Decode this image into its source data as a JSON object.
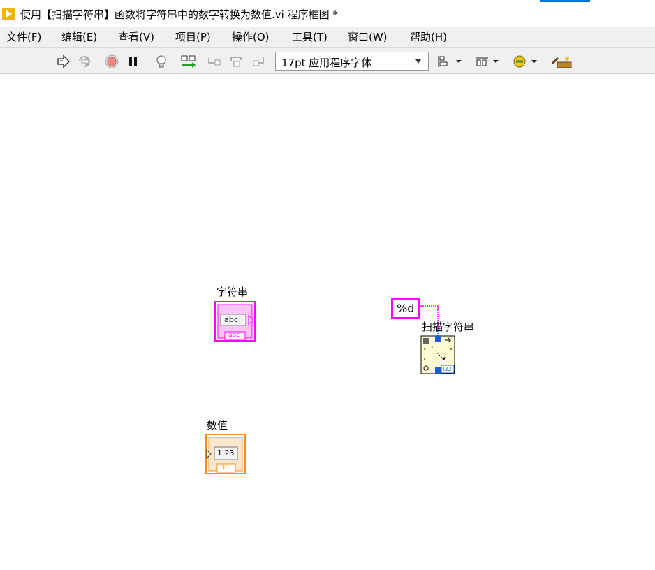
{
  "window": {
    "title": "使用【扫描字符串】函数将字符串中的数字转换为数值.vi 程序框图 *"
  },
  "menu": {
    "items": [
      {
        "label": "文件(F)"
      },
      {
        "label": "编辑(E)"
      },
      {
        "label": "查看(V)"
      },
      {
        "label": "项目(P)"
      },
      {
        "label": "操作(O)"
      },
      {
        "label": "工具(T)"
      },
      {
        "label": "窗口(W)"
      },
      {
        "label": "帮助(H)"
      }
    ]
  },
  "toolbar": {
    "font_select_value": "17pt 应用程序字体",
    "buttons": [
      "run-arrow-icon",
      "run-continuously-icon",
      "abort-execution-icon",
      "pause-icon",
      "highlight-execution-icon",
      "retain-wire-values-icon",
      "step-into-icon",
      "step-over-icon",
      "step-out-icon",
      "align-objects-icon",
      "distribute-objects-icon",
      "reorder-icon",
      "clean-up-diagram-icon"
    ]
  },
  "diagram": {
    "string_control": {
      "label": "字符串",
      "display_text": "abc",
      "type_tag": "abc"
    },
    "numeric_indicator": {
      "label": "数值",
      "display_text": "1.23",
      "type_tag": "DBL"
    },
    "format_constant": {
      "value": "%d"
    },
    "scan_function": {
      "label": "扫描字符串",
      "output_tag": "I32"
    }
  },
  "colors": {
    "string_pink": "#ff00ff",
    "numeric_orange": "#ff8c1a",
    "logo_yellow": "#f2b200",
    "accent_blue": "#0078d7"
  }
}
